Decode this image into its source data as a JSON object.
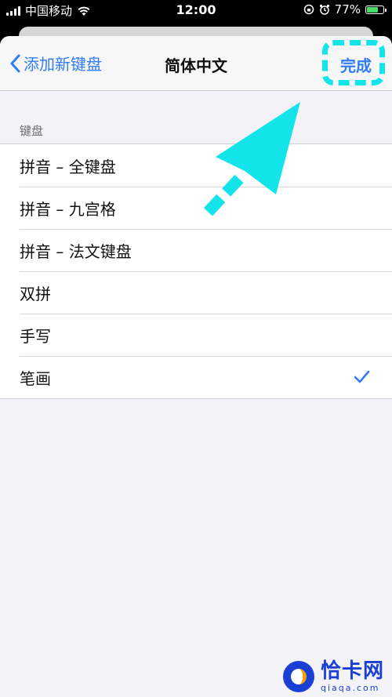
{
  "status_bar": {
    "carrier": "中国移动",
    "time": "12:00",
    "battery_percent": "77%",
    "battery_level": 0.77,
    "icons": [
      "signal-icon",
      "wifi-icon",
      "lock-rotation-icon",
      "alarm-icon",
      "battery-icon"
    ]
  },
  "nav": {
    "back_label": "添加新键盘",
    "title": "简体中文",
    "done_label": "完成"
  },
  "section": {
    "header": "键盘"
  },
  "keyboards": [
    {
      "label": "拼音 – 全键盘",
      "selected": false
    },
    {
      "label": "拼音 – 九宫格",
      "selected": false
    },
    {
      "label": "拼音 – 法文键盘",
      "selected": false
    },
    {
      "label": "双拼",
      "selected": false
    },
    {
      "label": "手写",
      "selected": false
    },
    {
      "label": "笔画",
      "selected": true
    }
  ],
  "colors": {
    "accent": "#2f7cf6",
    "annotation": "#12e4ea",
    "battery": "#4cd964"
  },
  "watermark": {
    "text": "恰卡网",
    "sub": "qiaqa.com"
  }
}
